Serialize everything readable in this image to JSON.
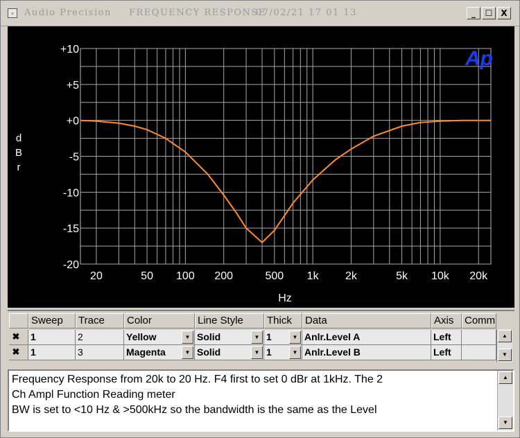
{
  "window": {
    "app_title": "Audio Precision",
    "doc_title": "FREQUENCY RESPONSE",
    "datetime": "07/02/21 17 01 13",
    "minimize_glyph": "_",
    "maximize_glyph": "☐",
    "close_glyph": "X"
  },
  "graph": {
    "logo_text": "Ap",
    "y_label": "dBr",
    "x_label": "Hz"
  },
  "chart_data": {
    "type": "line",
    "xlabel": "Hz",
    "ylabel": "dBr",
    "xscale": "log",
    "xlim": [
      15,
      25000
    ],
    "ylim": [
      -20,
      10
    ],
    "grid": true,
    "x_tick_values": [
      20,
      50,
      100,
      200,
      500,
      1000,
      2000,
      5000,
      10000,
      20000
    ],
    "x_tick_labels": [
      "20",
      "50",
      "100",
      "200",
      "500",
      "1k",
      "2k",
      "5k",
      "10k",
      "20k"
    ],
    "y_tick_values": [
      10,
      5,
      0,
      -5,
      -10,
      -15,
      -20
    ],
    "y_tick_labels": [
      "+10",
      "+5",
      "+0",
      "-5",
      "-10",
      "-15",
      "-20"
    ],
    "series": [
      {
        "color": "#ff8a2a",
        "x": [
          15,
          20,
          30,
          40,
          50,
          70,
          100,
          150,
          200,
          250,
          300,
          400,
          500,
          700,
          1000,
          1500,
          2000,
          3000,
          5000,
          7000,
          10000,
          15000,
          20000,
          25000
        ],
        "y": [
          0,
          -0.1,
          -0.4,
          -0.8,
          -1.3,
          -2.5,
          -4.4,
          -7.5,
          -10.4,
          -12.8,
          -15,
          -17,
          -15.3,
          -11.5,
          -8.3,
          -5.5,
          -4,
          -2.2,
          -0.8,
          -0.3,
          -0.1,
          0,
          0,
          0
        ]
      },
      {
        "color": "#d8306e",
        "x": [
          15,
          20,
          30,
          40,
          50,
          70,
          100,
          150,
          200,
          250,
          300,
          400,
          500,
          700,
          1000,
          1500,
          2000,
          3000,
          5000,
          7000,
          10000,
          15000,
          20000,
          25000
        ],
        "y": [
          0,
          -0.1,
          -0.4,
          -0.8,
          -1.3,
          -2.5,
          -4.4,
          -7.5,
          -10.4,
          -12.8,
          -15,
          -17,
          -15.3,
          -11.5,
          -8.3,
          -5.5,
          -4,
          -2.2,
          -0.8,
          -0.3,
          -0.1,
          0,
          0,
          0
        ]
      }
    ]
  },
  "sweep_table": {
    "headers": [
      "Sweep",
      "Trace",
      "Color",
      "Line Style",
      "Thick",
      "Data",
      "Axis",
      "Comm"
    ],
    "rows": [
      {
        "checked": "✖",
        "sweep": "1",
        "trace": "2",
        "color": "Yellow",
        "line_style": "Solid",
        "thick": "1",
        "data": "Anlr.Level A",
        "axis": "Left"
      },
      {
        "checked": "✖",
        "sweep": "1",
        "trace": "3",
        "color": "Magenta",
        "line_style": "Solid",
        "thick": "1",
        "data": "Anlr.Level B",
        "axis": "Left"
      }
    ]
  },
  "notes": {
    "lines": [
      "Frequency Response from 20k to 20 Hz.  F4 first to set 0 dBr at 1kHz.  The 2",
      "Ch Ampl Function Reading meter",
      "BW is set to <10 Hz & >500kHz so the bandwidth is the same as the Level"
    ]
  },
  "icons": {
    "dropdown_arrow": "▼",
    "scroll_up": "▲",
    "scroll_down": "▼"
  }
}
